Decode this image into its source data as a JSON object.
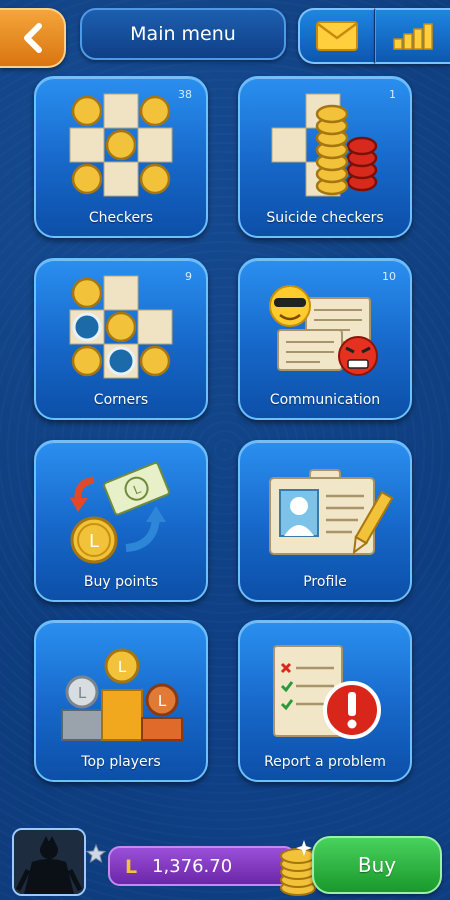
{
  "header": {
    "title": "Main menu",
    "back_icon": "back-arrow-icon",
    "mail_icon": "envelope-icon",
    "stats_icon": "bar-chart-icon"
  },
  "tiles": [
    {
      "label": "Checkers",
      "count": "38",
      "icon": "checkers-board-icon"
    },
    {
      "label": "Suicide checkers",
      "count": "1",
      "icon": "suicide-checkers-icon"
    },
    {
      "label": "Corners",
      "count": "9",
      "icon": "corners-board-icon"
    },
    {
      "label": "Communication",
      "count": "10",
      "icon": "chat-emoji-icon"
    },
    {
      "label": "Buy points",
      "count": "",
      "icon": "exchange-coins-icon"
    },
    {
      "label": "Profile",
      "count": "",
      "icon": "profile-card-icon"
    },
    {
      "label": "Top players",
      "count": "",
      "icon": "podium-medals-icon"
    },
    {
      "label": "Report a problem",
      "count": "",
      "icon": "report-warning-icon"
    }
  ],
  "bottom": {
    "balance": "1,376.70",
    "currency_icon": "l-coin-icon",
    "buy_label": "Buy",
    "avatar_icon": "player-avatar",
    "star_icon": "star-icon"
  },
  "colors": {
    "background": "#0d3a78",
    "tile": "#1667c8",
    "accent_orange": "#e88a20",
    "balance_purple": "#7d35bd",
    "buy_green": "#22a636",
    "coin_gold": "#f2c23a"
  }
}
